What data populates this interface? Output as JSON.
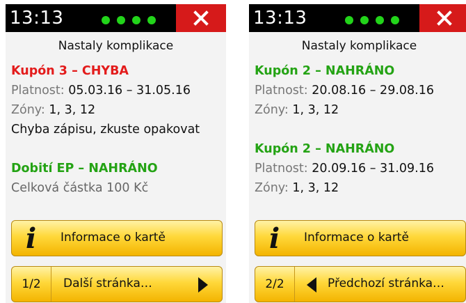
{
  "colors": {
    "error": "#e31b1b",
    "success": "#24a314",
    "button": "#ffd83a",
    "close": "#d61a1a",
    "signal": "#22d41a"
  },
  "left": {
    "time": "13:13",
    "title": "Nastaly komplikace",
    "coupon": {
      "heading": "Kupón 3 – CHYBA",
      "validity_label": "Platnost: ",
      "validity_value": "05.03.16 – 31.05.16",
      "zones_label": "Zóny: ",
      "zones_value": "1, 3, 12",
      "message": "Chyba zápisu, zkuste opakovat"
    },
    "topup": {
      "heading": "Dobití EP – NAHRÁNO",
      "amount": "Celková částka 100 Kč"
    },
    "info_button": {
      "icon": "info-icon",
      "label": "Informace o kartě"
    },
    "nav_button": {
      "page": "1/2",
      "label": "Další stránka…",
      "icon": "arrow-right-icon"
    }
  },
  "right": {
    "time": "13:13",
    "title": "Nastaly komplikace",
    "coupons": [
      {
        "heading": "Kupón 2 – NAHRÁNO",
        "validity_label": "Platnost: ",
        "validity_value": "20.08.16 – 29.08.16",
        "zones_label": "Zóny: ",
        "zones_value": "1, 3, 12"
      },
      {
        "heading": "Kupón 2 – NAHRÁNO",
        "validity_label": "Platnost: ",
        "validity_value": "20.09.16 – 31.09.16",
        "zones_label": "Zóny: ",
        "zones_value": "1, 3, 12"
      }
    ],
    "info_button": {
      "icon": "info-icon",
      "label": "Informace o kartě"
    },
    "nav_button": {
      "page": "2/2",
      "label": "Předchozí stránka…",
      "icon": "arrow-left-icon"
    }
  }
}
